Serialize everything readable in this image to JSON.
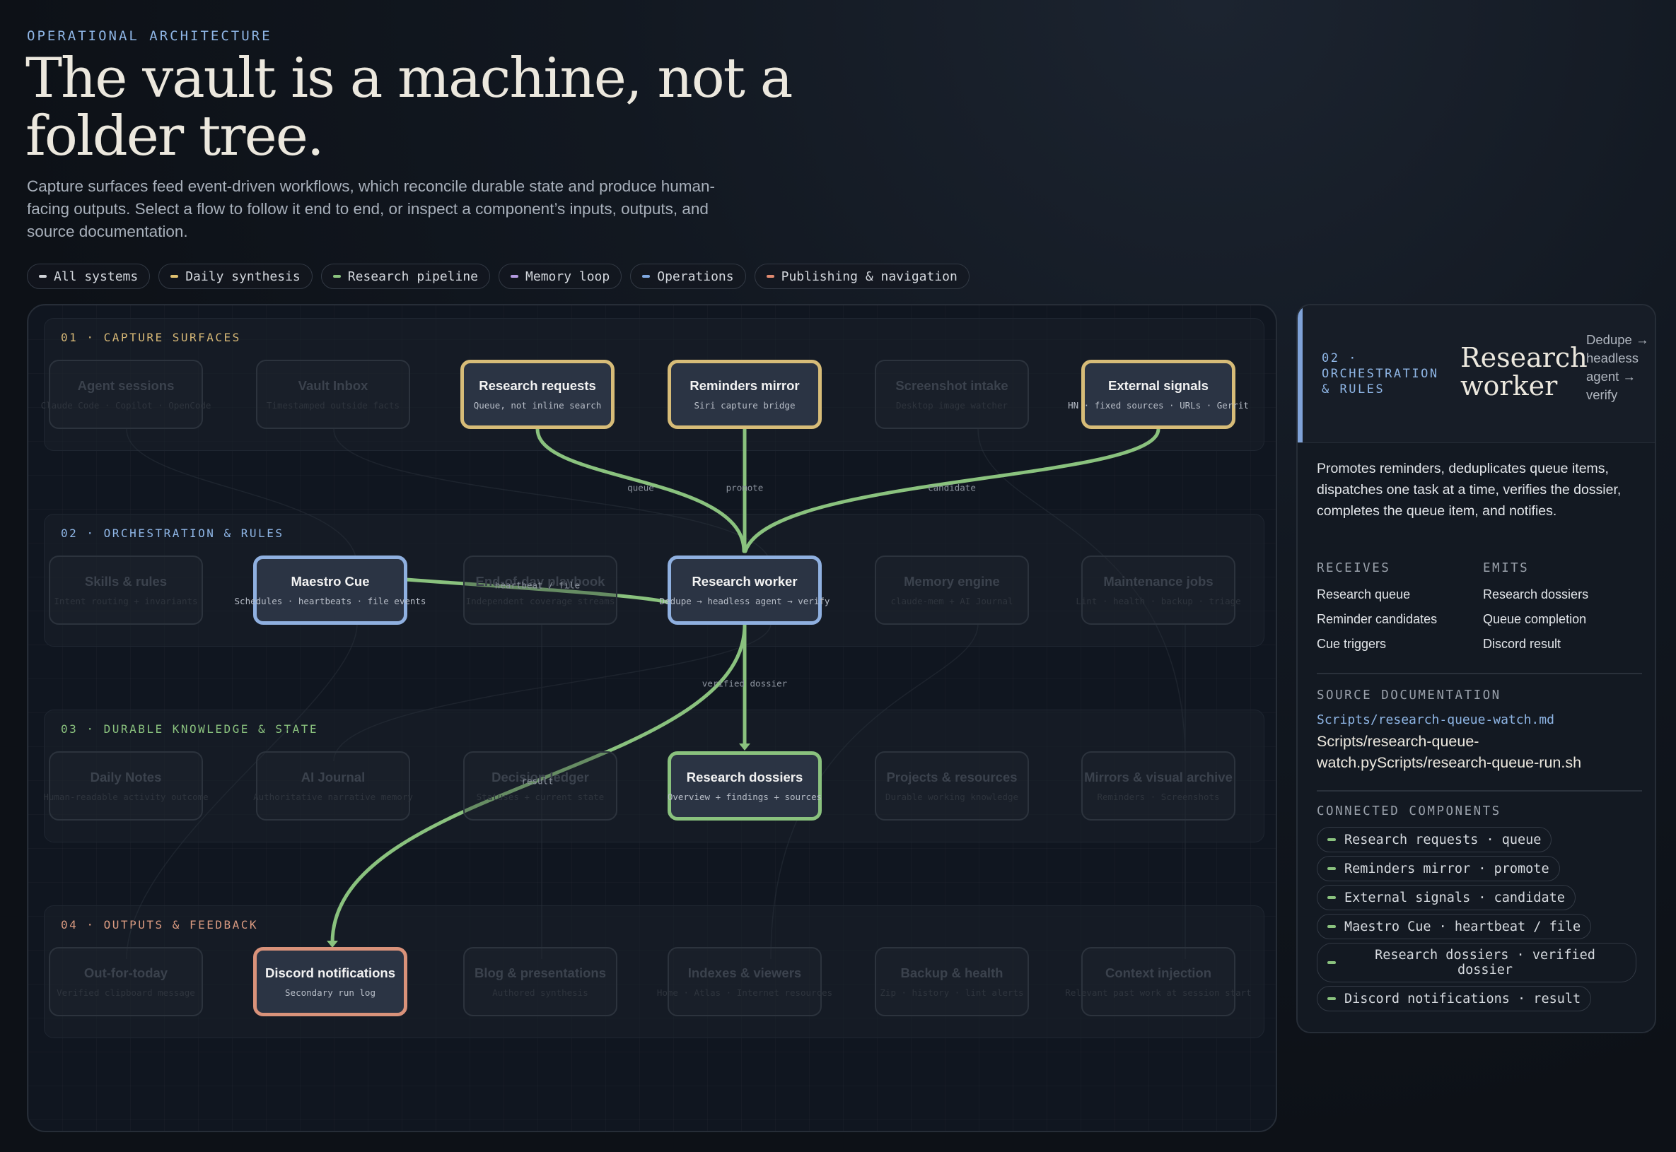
{
  "header": {
    "eyebrow": "OPERATIONAL ARCHITECTURE",
    "title": "The vault is a machine, not a folder tree.",
    "intro": "Capture surfaces feed event-driven workflows, which reconcile durable state and produce human-facing outputs. Select a flow to follow it end to end, or inspect a component’s inputs, outputs, and source documentation."
  },
  "filters": [
    {
      "label": "All systems",
      "color": "#d0d3d8"
    },
    {
      "label": "Daily synthesis",
      "color": "#e0c070"
    },
    {
      "label": "Research pipeline",
      "color": "#8ac27e"
    },
    {
      "label": "Memory loop",
      "color": "#b49ae0"
    },
    {
      "label": "Operations",
      "color": "#7fa8e0"
    },
    {
      "label": "Publishing & navigation",
      "color": "#e08a70"
    }
  ],
  "bands": [
    {
      "label": "01 · CAPTURE SURFACES",
      "color": "#d7b876"
    },
    {
      "label": "02 · ORCHESTRATION & RULES",
      "color": "#8fb6e6"
    },
    {
      "label": "03 · DURABLE KNOWLEDGE & STATE",
      "color": "#8ac27e"
    },
    {
      "label": "04 · OUTPUTS & FEEDBACK",
      "color": "#d99a80"
    }
  ],
  "nodes": {
    "agent_sessions": {
      "title": "Agent sessions",
      "subtitle": "Claude Code · Copilot · OpenCode"
    },
    "vault_inbox": {
      "title": "Vault Inbox",
      "subtitle": "Timestamped outside facts"
    },
    "research_requests": {
      "title": "Research requests",
      "subtitle": "Queue, not inline search"
    },
    "reminders_mirror": {
      "title": "Reminders mirror",
      "subtitle": "Siri capture bridge"
    },
    "screenshot_intake": {
      "title": "Screenshot intake",
      "subtitle": "Desktop image watcher"
    },
    "external_signals": {
      "title": "External signals",
      "subtitle": "HN · fixed sources · URLs · Gerrit"
    },
    "skills_rules": {
      "title": "Skills & rules",
      "subtitle": "Intent routing + invariants"
    },
    "maestro_cue": {
      "title": "Maestro Cue",
      "subtitle": "Schedules · heartbeats · file events"
    },
    "end_of_day": {
      "title": "End-of-day playbook",
      "subtitle": "Independent coverage streams"
    },
    "research_worker": {
      "title": "Research worker",
      "subtitle": "Dedupe → headless agent → verify"
    },
    "memory_engine": {
      "title": "Memory engine",
      "subtitle": "claude-mem + AI Journal"
    },
    "maintenance_jobs": {
      "title": "Maintenance jobs",
      "subtitle": "Lint · health · backup · triage"
    },
    "daily_notes": {
      "title": "Daily Notes",
      "subtitle": "Human-readable activity outcome"
    },
    "ai_journal": {
      "title": "AI Journal",
      "subtitle": "Authoritative narrative memory"
    },
    "decision_ledger": {
      "title": "Decision ledger",
      "subtitle": "Statuses + current state"
    },
    "research_dossiers": {
      "title": "Research dossiers",
      "subtitle": "Overview + findings + sources"
    },
    "projects_resources": {
      "title": "Projects & resources",
      "subtitle": "Durable working knowledge"
    },
    "mirrors_archive": {
      "title": "Mirrors & visual archive",
      "subtitle": "Reminders · Screenshots"
    },
    "out_for_today": {
      "title": "Out-for-today",
      "subtitle": "Verified clipboard message"
    },
    "discord_notifications": {
      "title": "Discord notifications",
      "subtitle": "Secondary run log"
    },
    "blog_presentations": {
      "title": "Blog & presentations",
      "subtitle": "Authored synthesis"
    },
    "indexes_viewers": {
      "title": "Indexes & viewers",
      "subtitle": "Home · Atlas · Internet resources"
    },
    "backup_health": {
      "title": "Backup & health",
      "subtitle": "Zip · history · lint alerts"
    },
    "context_injection": {
      "title": "Context injection",
      "subtitle": "Relevant past work at session start"
    }
  },
  "edge_labels": {
    "queue": "queue",
    "promote": "promote",
    "candidate": "candidate",
    "heartbeat_file": "heartbeat / file",
    "verified_dossier": "verified dossier",
    "result": "result"
  },
  "panel": {
    "kicker": "02 · ORCHESTRATION & RULES",
    "title": "Research worker",
    "flow": "Dedupe → headless agent → verify",
    "description": "Promotes reminders, deduplicates queue items, dispatches one task at a time, verifies the dossier, completes the queue item, and notifies.",
    "receives_label": "RECEIVES",
    "emits_label": "EMITS",
    "receives": [
      "Research queue",
      "Reminder candidates",
      "Cue triggers"
    ],
    "emits": [
      "Research dossiers",
      "Queue completion",
      "Discord result"
    ],
    "source_label": "SOURCE DOCUMENTATION",
    "source_link": "Scripts/research-queue-watch.md",
    "source_text": "Scripts/research-queue-watch.pyScripts/research-queue-run.sh",
    "connected_label": "CONNECTED COMPONENTS",
    "connected": [
      "Research requests · queue",
      "Reminders mirror · promote",
      "External signals · candidate",
      "Maestro Cue · heartbeat / file",
      "Research dossiers · verified dossier",
      "Discord notifications · result"
    ]
  },
  "colors": {
    "capture": "#d7bc78",
    "orchestration": "#8fb0e0",
    "knowledge": "#8ac27e",
    "output": "#d9927a",
    "edge": "#8ac27e"
  }
}
